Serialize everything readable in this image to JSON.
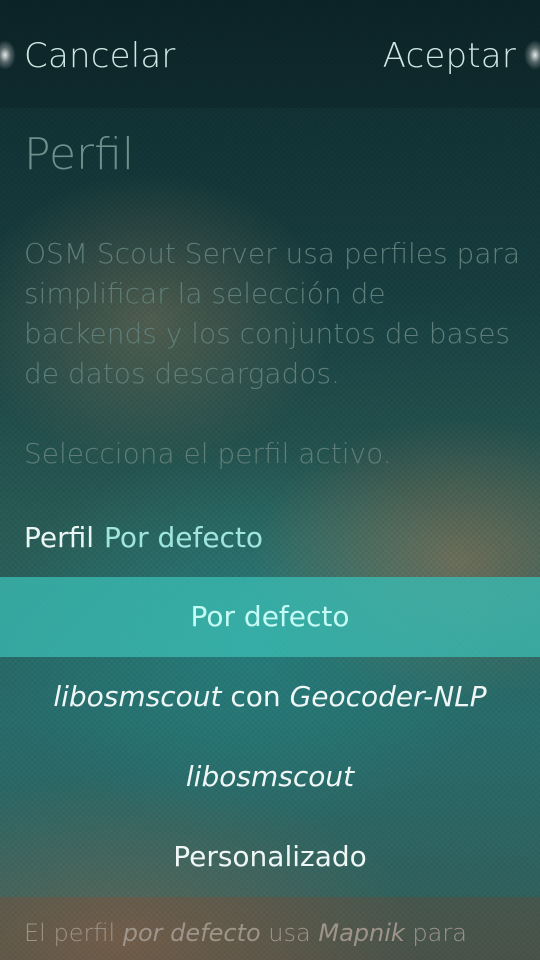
{
  "header": {
    "cancel_label": "Cancelar",
    "accept_label": "Aceptar"
  },
  "page": {
    "title": "Perfil",
    "description": "OSM Scout Server usa perfiles para simplificar la selección de backends y los conjuntos de bases de datos descargados.",
    "select_hint": "Selecciona el perfil activo."
  },
  "combo": {
    "label": "Perfil",
    "value": "Por defecto"
  },
  "menu": {
    "items": [
      {
        "text": "Por defecto",
        "selected": true
      },
      {
        "part1": "libosmscout",
        "part2": " con ",
        "part3": "Geocoder-NLP",
        "selected": false
      },
      {
        "text": "libosmscout",
        "selected": false
      },
      {
        "text": "Personalizado",
        "selected": false
      }
    ]
  },
  "footer": {
    "part1": "El perfil ",
    "part2": "por defecto",
    "part3": " usa ",
    "part4": "Mapnik",
    "part5": " para"
  },
  "colors": {
    "accent": "#9fe6df",
    "highlight_bg": "#3cbeb4"
  }
}
